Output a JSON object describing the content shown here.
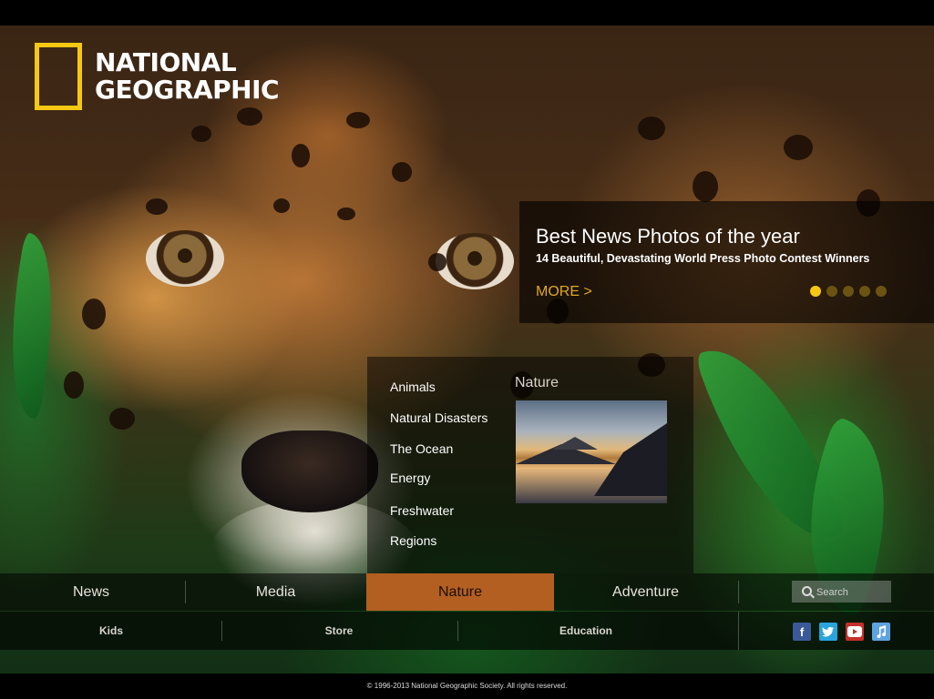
{
  "logo": {
    "line1": "NATIONAL",
    "line2": "GEOGRAPHIC",
    "accent": "#f6c813"
  },
  "feature": {
    "title": "Best News Photos of the year",
    "subtitle": "14 Beautiful, Devastating World Press Photo Contest Winners",
    "more_label": "MORE >",
    "slide_count": 5,
    "active_slide": 1
  },
  "dropdown": {
    "heading": "Nature",
    "items": [
      "Animals",
      "Natural Disasters",
      "The Ocean",
      "Energy",
      "Freshwater",
      "Regions"
    ]
  },
  "nav": {
    "items": [
      {
        "label": "News"
      },
      {
        "label": "Media"
      },
      {
        "label": "Nature",
        "active": true
      },
      {
        "label": "Adventure"
      }
    ],
    "active_color": "#b35f21",
    "search_placeholder": "Search"
  },
  "subnav": {
    "items": [
      {
        "label": "Kids"
      },
      {
        "label": "Store"
      },
      {
        "label": "Education"
      }
    ],
    "social": [
      "facebook-icon",
      "twitter-icon",
      "youtube-icon",
      "itunes-icon"
    ]
  },
  "footer": {
    "copyright": "© 1996-2013 National Geographic Society. All rights reserved."
  }
}
